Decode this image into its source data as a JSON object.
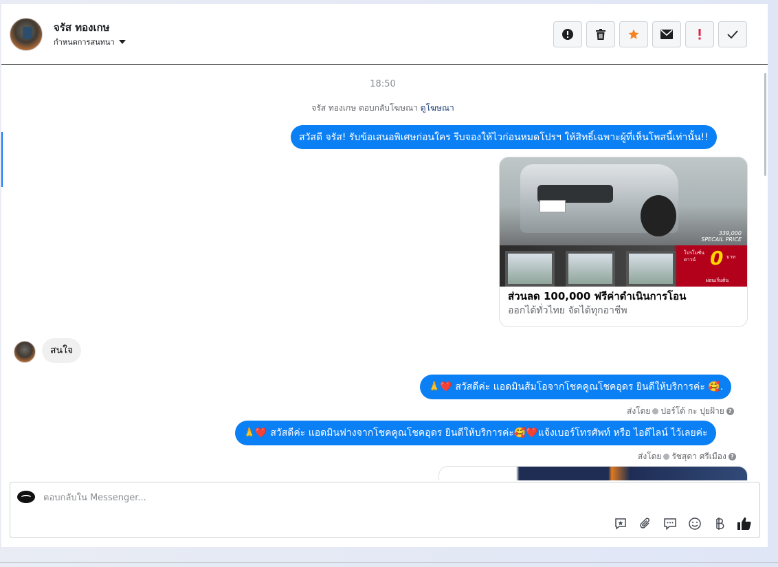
{
  "header": {
    "contact_name": "จรัส ทองเกษ",
    "conversation_label": "กำหนดการสนทนา",
    "actions": [
      {
        "name": "report-button",
        "icon": "alert-circle-icon"
      },
      {
        "name": "delete-button",
        "icon": "trash-icon"
      },
      {
        "name": "star-button",
        "icon": "star-icon"
      },
      {
        "name": "mark-unread-button",
        "icon": "envelope-icon"
      },
      {
        "name": "spam-button",
        "icon": "exclamation-icon"
      },
      {
        "name": "done-button",
        "icon": "check-icon"
      }
    ]
  },
  "chat": {
    "time": "18:50",
    "reply_note_prefix": "จรัส ทองเกษ ตอบกลับโฆษณา",
    "reply_note_link": "ดูโฆษณา",
    "msg1": "สวัสดี จรัส! รับข้อเสนอพิเศษก่อนใคร รีบจองให้ไวก่อนหมดโปรฯ ให้สิทธิ์เฉพาะผู้ที่เห็นโพสนี้เท่านั้น!!",
    "ad": {
      "title": "ส่วนลด 100,000 ฟรีค่าดำเนินการโอน",
      "subtitle": "ออกได้ทั่วไทย จัดได้ทุกอาชีพ",
      "price_line1": "339,000",
      "price_line2": "SPECAIL PRICE",
      "promo_text_1": "โปรโมชั่น",
      "promo_text_2": "ดาวน์",
      "promo_zero": "0",
      "promo_text_3": "บาท",
      "promo_text_4": "ผ่อนเริ่มต้น"
    },
    "incoming_msg": "สนใจ",
    "msg2": "🙏❤️ สวัสดีค่ะ แอดมินส้มโอจากโชคคูณโชคอุดร ยินดีให้บริการค่ะ 🥰.",
    "sent_by_label": "ส่งโดย",
    "sender1": "ปอร์โต้ กะ ปุยฝ้าย",
    "msg3": "🙏❤️ สวัสดีค่ะ แอดมินฟางจากโชคคูณโชคอุดร ยินดีให้บริการค่ะ🥰❤️แจ้งเบอร์โทรศัพท์ หรือ ไอดีไลน์ ไว้เลยค่ะ",
    "sender2": "รัชสุดา ศรีเมือง"
  },
  "composer": {
    "placeholder": "ตอบกลับใน Messenger...",
    "tools": [
      "saved-reply-icon",
      "attachment-icon",
      "chat-bubble-icon",
      "emoji-icon",
      "baht-icon",
      "like-icon"
    ]
  },
  "colors": {
    "outgoing_bubble": "#0b7ff4",
    "incoming_bubble": "#f0f0f0",
    "star": "#f5821f",
    "spam": "#e41e3f"
  }
}
